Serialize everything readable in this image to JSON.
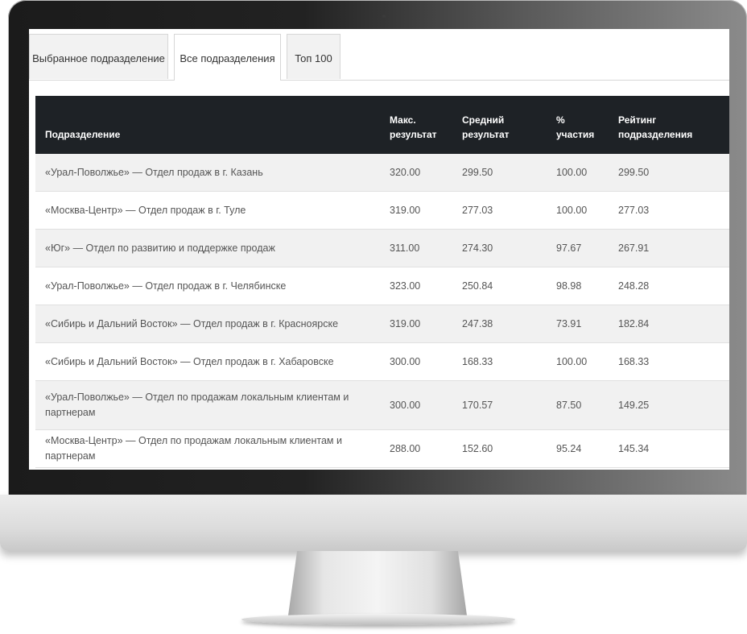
{
  "tabs": [
    {
      "label": "Выбранное подразделение"
    },
    {
      "label": "Все подразделения"
    },
    {
      "label": "Топ 100"
    }
  ],
  "table": {
    "headers": {
      "division": "Подразделение",
      "max_line1": "Макс.",
      "max_line2": "результат",
      "avg_line1": "Средний",
      "avg_line2": "результат",
      "part_line1": "%",
      "part_line2": "участия",
      "rating_line1": "Рейтинг",
      "rating_line2": "подразделения"
    },
    "rows": [
      [
        "«Урал-Поволжье» — Отдел продаж в г. Казань",
        "320.00",
        "299.50",
        "100.00",
        "299.50"
      ],
      [
        "«Москва-Центр» — Отдел продаж в г. Туле",
        "319.00",
        "277.03",
        "100.00",
        "277.03"
      ],
      [
        "«Юг» — Отдел по развитию и поддержке продаж",
        "311.00",
        "274.30",
        "97.67",
        "267.91"
      ],
      [
        "«Урал-Поволжье» — Отдел продаж в г. Челябинске",
        "323.00",
        "250.84",
        "98.98",
        "248.28"
      ],
      [
        "«Сибирь и Дальний Восток» — Отдел продаж в г. Красноярске",
        "319.00",
        "247.38",
        "73.91",
        "182.84"
      ],
      [
        "«Сибирь и Дальний Восток» — Отдел продаж в г. Хабаровске",
        "300.00",
        "168.33",
        "100.00",
        "168.33"
      ],
      [
        "«Урал-Поволжье» — Отдел по продажам локальным клиентам и партнерам",
        "300.00",
        "170.57",
        "87.50",
        "149.25"
      ],
      [
        "«Москва-Центр» — Отдел по продажам локальным клиентам и партнерам",
        "288.00",
        "152.60",
        "95.24",
        "145.34"
      ]
    ]
  },
  "colors": {
    "header_bg": "#1e2226",
    "row_stripe": "#f1f1f1",
    "text": "#555555"
  }
}
